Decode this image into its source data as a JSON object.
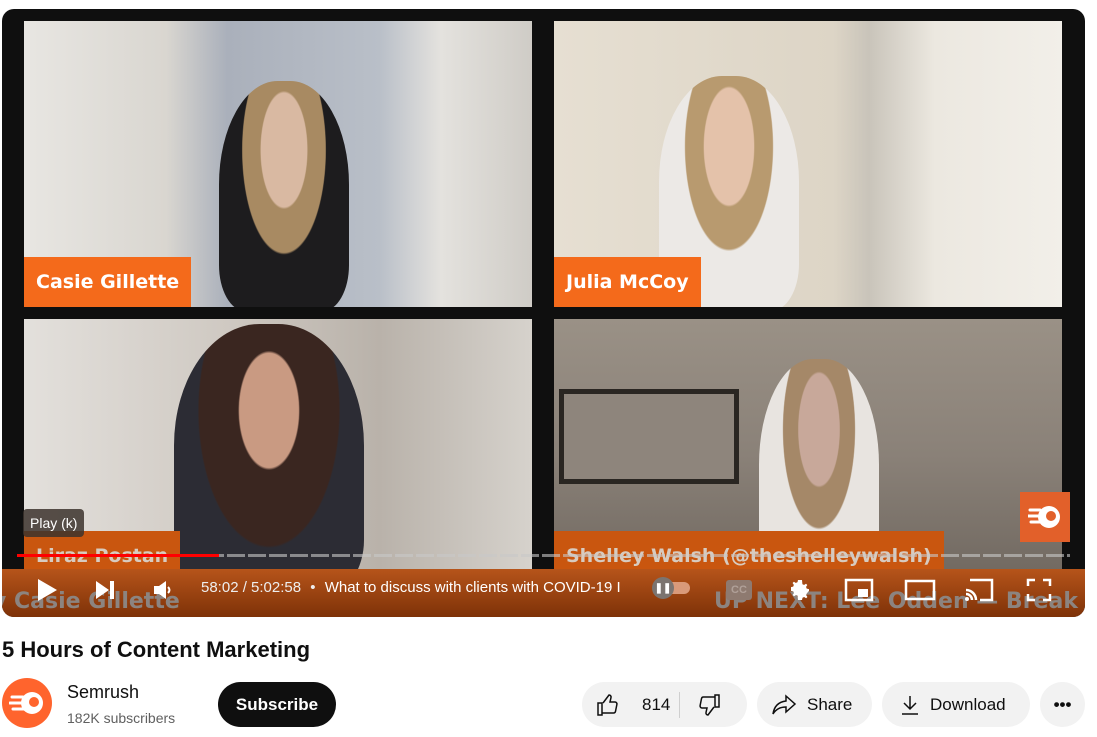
{
  "player": {
    "participants": [
      {
        "name": "Casie Gillette"
      },
      {
        "name": "Julia McCoy"
      },
      {
        "name": "Liraz Postan"
      },
      {
        "name": "Shelley Walsh (@theshelleywalsh)"
      }
    ],
    "ticker_left": "y Casie Gillette",
    "ticker_right": "UP NEXT: Lee Odden — Break Fr",
    "tooltip": "Play (k)",
    "progress_percent": 19.2,
    "current_time": "58:02",
    "duration": "5:02:58",
    "time_display": "58:02 / 5:02:58",
    "separator": "•",
    "chapter_title": "What to discuss with clients with COVID-19 I",
    "autoplay": "paused",
    "controls": {
      "play": "play-icon",
      "next": "next-icon",
      "volume": "volume-icon",
      "captions": "CC",
      "settings": "gear-icon",
      "miniplayer": "miniplayer-icon",
      "theater": "theater-icon",
      "cast": "cast-icon",
      "fullscreen": "fullscreen-icon"
    },
    "brand_color": "#f46a1b"
  },
  "video": {
    "title": "5 Hours of Content Marketing"
  },
  "channel": {
    "name": "Semrush",
    "subscribers": "182K subscribers",
    "subscribe_label": "Subscribe",
    "avatar_color": "#ff642d"
  },
  "actions": {
    "likes": "814",
    "share_label": "Share",
    "download_label": "Download",
    "more_label": "•••"
  }
}
